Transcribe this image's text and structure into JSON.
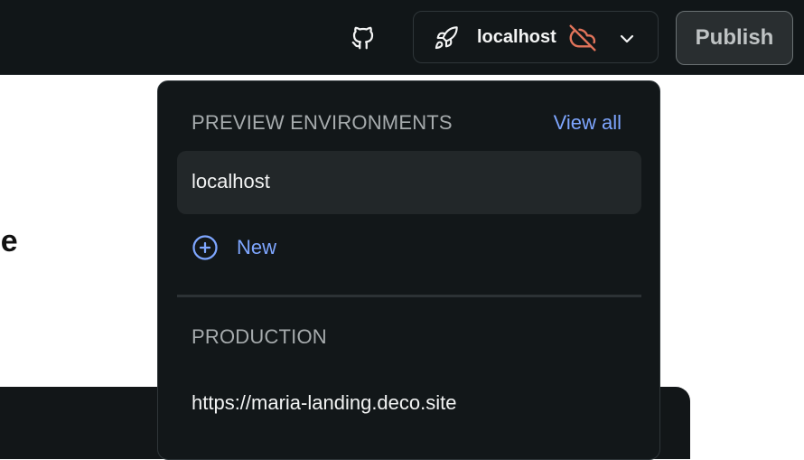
{
  "header": {
    "environment": "localhost",
    "publish_label": "Publish"
  },
  "background": {
    "heading_fragment": "ne"
  },
  "dropdown": {
    "preview_title": "PREVIEW ENVIRONMENTS",
    "view_all_label": "View all",
    "preview_items": [
      {
        "label": "localhost"
      }
    ],
    "new_label": "New",
    "production_title": "PRODUCTION",
    "production_url": "https://maria-landing.deco.site"
  },
  "colors": {
    "accent": "#7ea6ff",
    "cloud_off": "#e0735a",
    "topbar_bg": "#111618"
  },
  "icons": [
    "github-icon",
    "rocket-icon",
    "cloud-off-icon",
    "chevron-down-icon",
    "plus-circle-icon"
  ]
}
